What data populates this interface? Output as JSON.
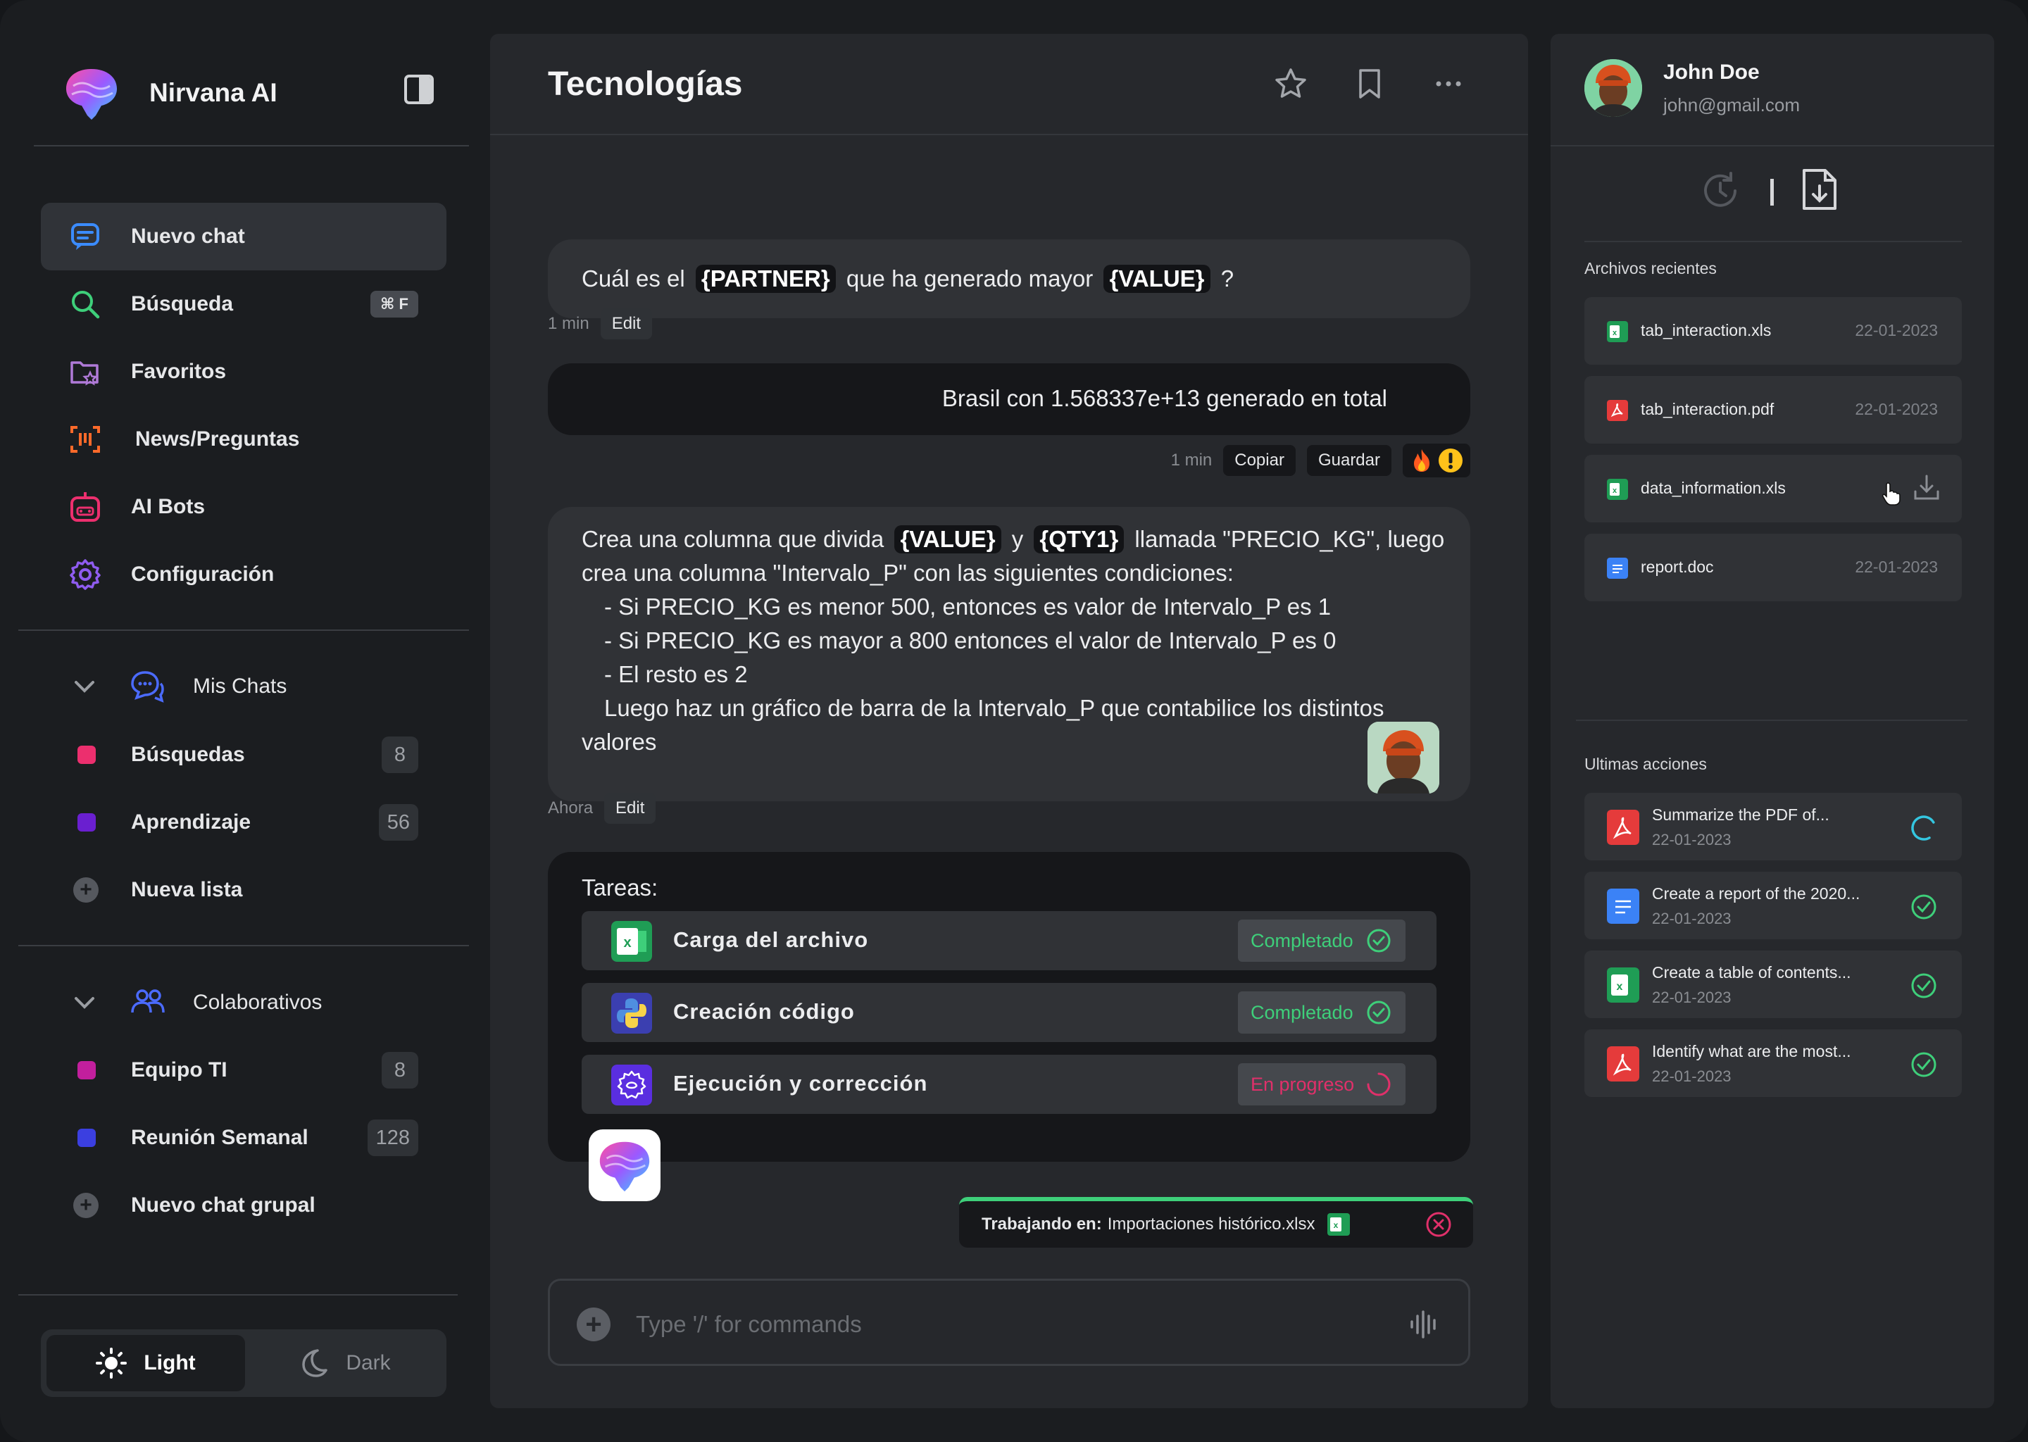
{
  "app": {
    "name": "Nirvana AI",
    "accent_green": "#3ecf7a",
    "accent_pink": "#e0306a"
  },
  "sidebar": {
    "nav": [
      {
        "label": "Nuevo chat",
        "icon": "chat-bubble-icon",
        "active": true
      },
      {
        "label": "Búsqueda",
        "icon": "search-icon",
        "shortcut": "⌘ F"
      },
      {
        "label": "Favoritos",
        "icon": "folder-star-icon"
      },
      {
        "label": "News/Preguntas",
        "icon": "scan-frame-icon"
      },
      {
        "label": "AI Bots",
        "icon": "robot-icon"
      },
      {
        "label": "Configuración",
        "icon": "gear-icon"
      }
    ],
    "mis_chats": {
      "title": "Mis Chats",
      "items": [
        {
          "label": "Búsquedas",
          "count": "8",
          "color": "#ec2f6e"
        },
        {
          "label": "Aprendizaje",
          "count": "56",
          "color": "#6a1fd0"
        }
      ],
      "new_label": "Nueva lista"
    },
    "colaborativos": {
      "title": "Colaborativos",
      "items": [
        {
          "label": "Equipo TI",
          "count": "8",
          "color": "#c21f9d"
        },
        {
          "label": "Reunión Semanal",
          "count": "128",
          "color": "#3b3fe0"
        }
      ],
      "new_label": "Nuevo chat grupal"
    },
    "theme": {
      "light": "Light",
      "dark": "Dark"
    }
  },
  "chat": {
    "title": "Tecnologías",
    "messages": {
      "q1": {
        "pre": "Cuál es el",
        "tag1": "{PARTNER}",
        "mid": "que ha generado mayor",
        "tag2": "{VALUE}",
        "post": "?",
        "time": "1 min",
        "edit": "Edit"
      },
      "a1": {
        "text": "Brasil con 1.568337e+13 generado en total",
        "time": "1 min",
        "copy": "Copiar",
        "save": "Guardar"
      },
      "q2": {
        "pre": "Crea una columna que divida",
        "tag1": "{VALUE}",
        "mid": "y",
        "tag2": "{QTY1}",
        "post": "llamada \"PRECIO_KG\", luego",
        "line2": "crea una columna \"Intervalo_P\" con las siguientes condiciones:",
        "line3": "- Si PRECIO_KG es menor 500, entonces es valor de Intervalo_P es 1",
        "line4": "- Si PRECIO_KG es mayor a 800 entonces el valor de Intervalo_P es 0",
        "line5": "- El resto es 2",
        "line6": "Luego haz un gráfico de barra de la Intervalo_P que contabilice los distintos",
        "line7": "valores",
        "time": "Ahora",
        "edit": "Edit"
      }
    },
    "tasks": {
      "title": "Tareas:",
      "items": [
        {
          "label": "Carga del archivo",
          "status": "Completado",
          "icon": "excel-icon"
        },
        {
          "label": "Creación código",
          "status": "Completado",
          "icon": "python-icon"
        },
        {
          "label": "Ejecución y corrección",
          "status": "En progreso",
          "icon": "ai-gear-icon"
        }
      ]
    },
    "working": {
      "label": "Trabajando en:",
      "file": "Importaciones histórico.xlsx"
    },
    "composer": {
      "placeholder": "Type '/' for commands"
    }
  },
  "profile": {
    "name": "John Doe",
    "email": "john@gmail.com"
  },
  "files": {
    "title": "Archivos recientes",
    "items": [
      {
        "name": "tab_interaction.xls",
        "date": "22-01-2023",
        "type": "xls"
      },
      {
        "name": "tab_interaction.pdf",
        "date": "22-01-2023",
        "type": "pdf"
      },
      {
        "name": "data_information.xls",
        "date": "",
        "type": "xls"
      },
      {
        "name": "report.doc",
        "date": "22-01-2023",
        "type": "doc"
      }
    ]
  },
  "actions": {
    "title": "Ultimas acciones",
    "items": [
      {
        "text": "Summarize the PDF of...",
        "date": "22-01-2023",
        "type": "pdf",
        "status": "loading"
      },
      {
        "text": "Create a report of the 2020...",
        "date": "22-01-2023",
        "type": "doc",
        "status": "done"
      },
      {
        "text": "Create a table of contents...",
        "date": "22-01-2023",
        "type": "xls",
        "status": "done"
      },
      {
        "text": "Identify what are the most...",
        "date": "22-01-2023",
        "type": "pdf",
        "status": "done"
      }
    ]
  }
}
